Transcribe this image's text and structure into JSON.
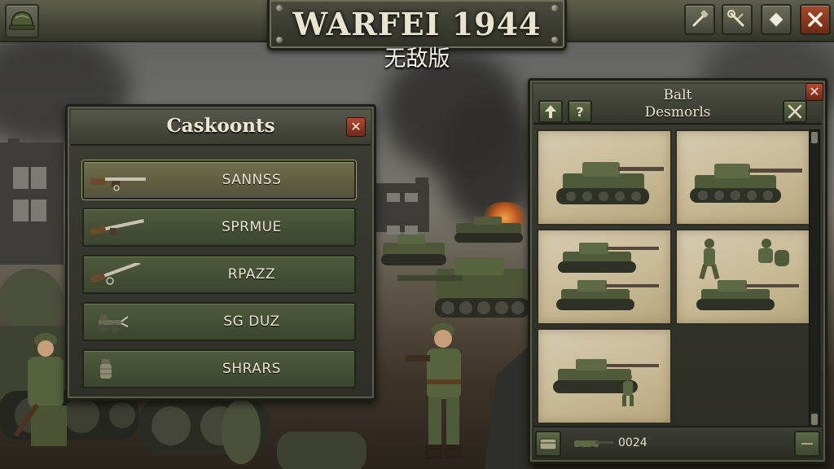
{
  "header": {
    "title": "WARFEI 1944",
    "subtitle": "无敌版",
    "buttons": [
      {
        "name": "build-tool-button",
        "icon": "shovel-icon"
      },
      {
        "name": "repair-tool-button",
        "icon": "wrench-icon"
      },
      {
        "name": "rank-button",
        "icon": "diamond-icon"
      },
      {
        "name": "close-game-button",
        "icon": "close-icon"
      }
    ]
  },
  "weapons_panel": {
    "title": "Caskoonts",
    "close_label": "✕",
    "items": [
      {
        "label": "SANNSS",
        "icon": "rifle-icon",
        "active": true
      },
      {
        "label": "SPRMUE",
        "icon": "rifle-icon",
        "active": false
      },
      {
        "label": "RPAZZ",
        "icon": "carbine-icon",
        "active": false
      },
      {
        "label": "SG DUZ",
        "icon": "mortar-icon",
        "active": false
      },
      {
        "label": "SHRARS",
        "icon": "grenade-icon",
        "active": false
      }
    ]
  },
  "units_panel": {
    "title_line1": "Balt",
    "title_line2": "Desmorls",
    "close_label": "✕",
    "up_label": "🡅",
    "help_label": "?",
    "cards": [
      {
        "content": "tank"
      },
      {
        "content": "tank"
      },
      {
        "content": "two-tanks"
      },
      {
        "content": "infantry-and-tank"
      },
      {
        "content": "tank-with-soldier"
      }
    ],
    "footer_count": "0024"
  },
  "colors": {
    "panel_dark": "#2e2f27",
    "olive_button": "#4f5a3c",
    "active_button": "#6e6d4c",
    "close_red": "#a8482e",
    "parchment": "#cdbf9c"
  }
}
